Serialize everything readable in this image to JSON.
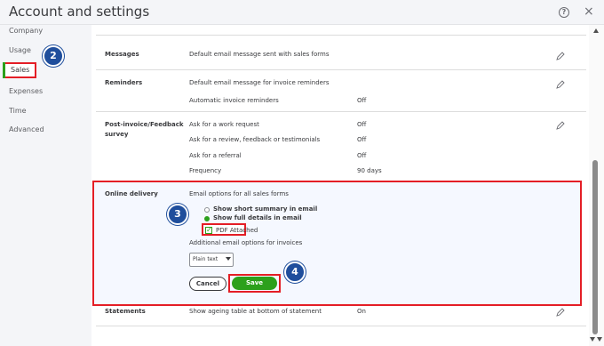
{
  "header": {
    "title": "Account and settings",
    "help_glyph": "?",
    "close_glyph": "×"
  },
  "sidebar": {
    "items": [
      {
        "label": "Company"
      },
      {
        "label": "Usage"
      },
      {
        "label": "Sales"
      },
      {
        "label": "Expenses"
      },
      {
        "label": "Time"
      },
      {
        "label": "Advanced"
      }
    ],
    "active_index": 2
  },
  "sections": {
    "messages": {
      "title": "Messages",
      "description": "Default email message sent with sales forms"
    },
    "reminders": {
      "title": "Reminders",
      "description": "Default email message for invoice reminders",
      "rows": [
        {
          "label": "Automatic invoice reminders",
          "value": "Off"
        }
      ]
    },
    "feedback": {
      "title_line1": "Post-invoice/Feedback",
      "title_line2": "survey",
      "rows": [
        {
          "label": "Ask for a work request",
          "value": "Off"
        },
        {
          "label": "Ask for a review, feedback or testimonials",
          "value": "Off"
        },
        {
          "label": "Ask for a referral",
          "value": "Off"
        },
        {
          "label": "Frequency",
          "value": "90 days"
        }
      ]
    },
    "online_delivery": {
      "title": "Online delivery",
      "email_options_label": "Email options for all sales forms",
      "radio_options": [
        {
          "label": "Show short summary in email",
          "selected": false
        },
        {
          "label": "Show full details in email",
          "selected": true
        }
      ],
      "pdf_attached_label": "PDF Attached",
      "pdf_attached_checked": true,
      "additional_label": "Additional email options for invoices",
      "format_select_value": "Plain text",
      "cancel_label": "Cancel",
      "save_label": "Save"
    },
    "statements": {
      "title": "Statements",
      "description": "Show ageing table at bottom of statement",
      "value": "On"
    }
  },
  "badges": [
    "2",
    "3",
    "4"
  ],
  "colors": {
    "accent_green": "#2ca01c",
    "annotation_red": "#e41e26",
    "badge_blue": "#1f4e9c",
    "sidebar_bg": "#f4f5f8"
  }
}
